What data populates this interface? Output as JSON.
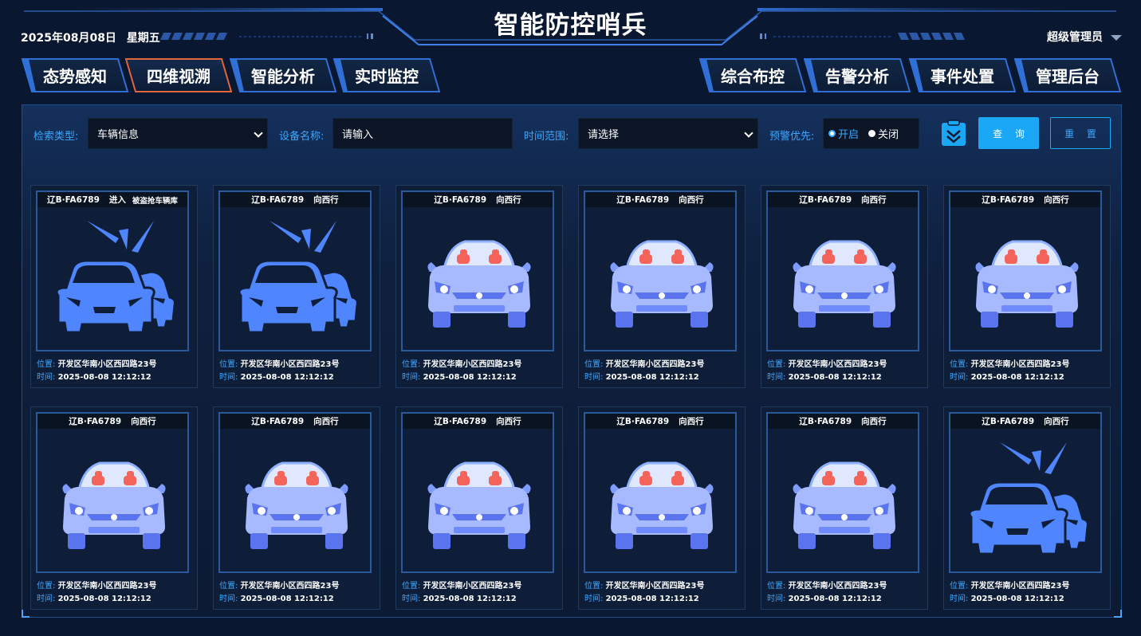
{
  "header": {
    "title": "智能防控哨兵",
    "date": "2025年08月08日",
    "weekday": "星期五",
    "user": "超级管理员"
  },
  "nav": {
    "left": [
      "态势感知",
      "四维视溯",
      "智能分析",
      "实时监控"
    ],
    "right": [
      "综合布控",
      "告警分析",
      "事件处置",
      "管理后台"
    ],
    "active": "四维视溯"
  },
  "filters": {
    "type_label": "检索类型:",
    "type_value": "车辆信息",
    "device_label": "设备名称:",
    "device_placeholder": "请输入",
    "time_label": "时间范围:",
    "time_value": "请选择",
    "priority_label": "预警优先:",
    "priority_on": "开启",
    "priority_off": "关闭",
    "query_button": "查 询",
    "reset_button": "重 置"
  },
  "cards": [
    {
      "plate": "辽B·FA6789",
      "direction": "进入",
      "alarm": "被盗抢车辆库",
      "location": "开发区华南小区西四路23号",
      "time": "2025-08-08 12:12:12",
      "icon": "alert-car-icon"
    },
    {
      "plate": "辽B·FA6789",
      "direction": "向西行",
      "alarm": "",
      "location": "开发区华南小区西四路23号",
      "time": "2025-08-08 12:12:12",
      "icon": "alert-car-icon"
    },
    {
      "plate": "辽B·FA6789",
      "direction": "向西行",
      "alarm": "",
      "location": "开发区华南小区西四路23号",
      "time": "2025-08-08 12:12:12",
      "icon": "car-front-icon"
    },
    {
      "plate": "辽B·FA6789",
      "direction": "向西行",
      "alarm": "",
      "location": "开发区华南小区西四路23号",
      "time": "2025-08-08 12:12:12",
      "icon": "car-front-icon"
    },
    {
      "plate": "辽B·FA6789",
      "direction": "向西行",
      "alarm": "",
      "location": "开发区华南小区西四路23号",
      "time": "2025-08-08 12:12:12",
      "icon": "car-front-icon"
    },
    {
      "plate": "辽B·FA6789",
      "direction": "向西行",
      "alarm": "",
      "location": "开发区华南小区西四路23号",
      "time": "2025-08-08 12:12:12",
      "icon": "car-front-icon"
    },
    {
      "plate": "辽B·FA6789",
      "direction": "向西行",
      "alarm": "",
      "location": "开发区华南小区西四路23号",
      "time": "2025-08-08 12:12:12",
      "icon": "car-front-icon"
    },
    {
      "plate": "辽B·FA6789",
      "direction": "向西行",
      "alarm": "",
      "location": "开发区华南小区西四路23号",
      "time": "2025-08-08 12:12:12",
      "icon": "car-front-icon"
    },
    {
      "plate": "辽B·FA6789",
      "direction": "向西行",
      "alarm": "",
      "location": "开发区华南小区西四路23号",
      "time": "2025-08-08 12:12:12",
      "icon": "car-front-icon"
    },
    {
      "plate": "辽B·FA6789",
      "direction": "向西行",
      "alarm": "",
      "location": "开发区华南小区西四路23号",
      "time": "2025-08-08 12:12:12",
      "icon": "car-front-icon"
    },
    {
      "plate": "辽B·FA6789",
      "direction": "向西行",
      "alarm": "",
      "location": "开发区华南小区西四路23号",
      "time": "2025-08-08 12:12:12",
      "icon": "car-front-icon"
    },
    {
      "plate": "辽B·FA6789",
      "direction": "向西行",
      "alarm": "",
      "location": "开发区华南小区西四路23号",
      "time": "2025-08-08 12:12:12",
      "icon": "alert-car-icon"
    }
  ],
  "labels": {
    "location": "位置:",
    "time": "时间:"
  },
  "colors": {
    "accent": "#39a8ff",
    "button": "#1aa7f5",
    "active_tab_border": "#e0643c",
    "car_blue": "#4f86ff",
    "seat_red": "#f4645a"
  }
}
